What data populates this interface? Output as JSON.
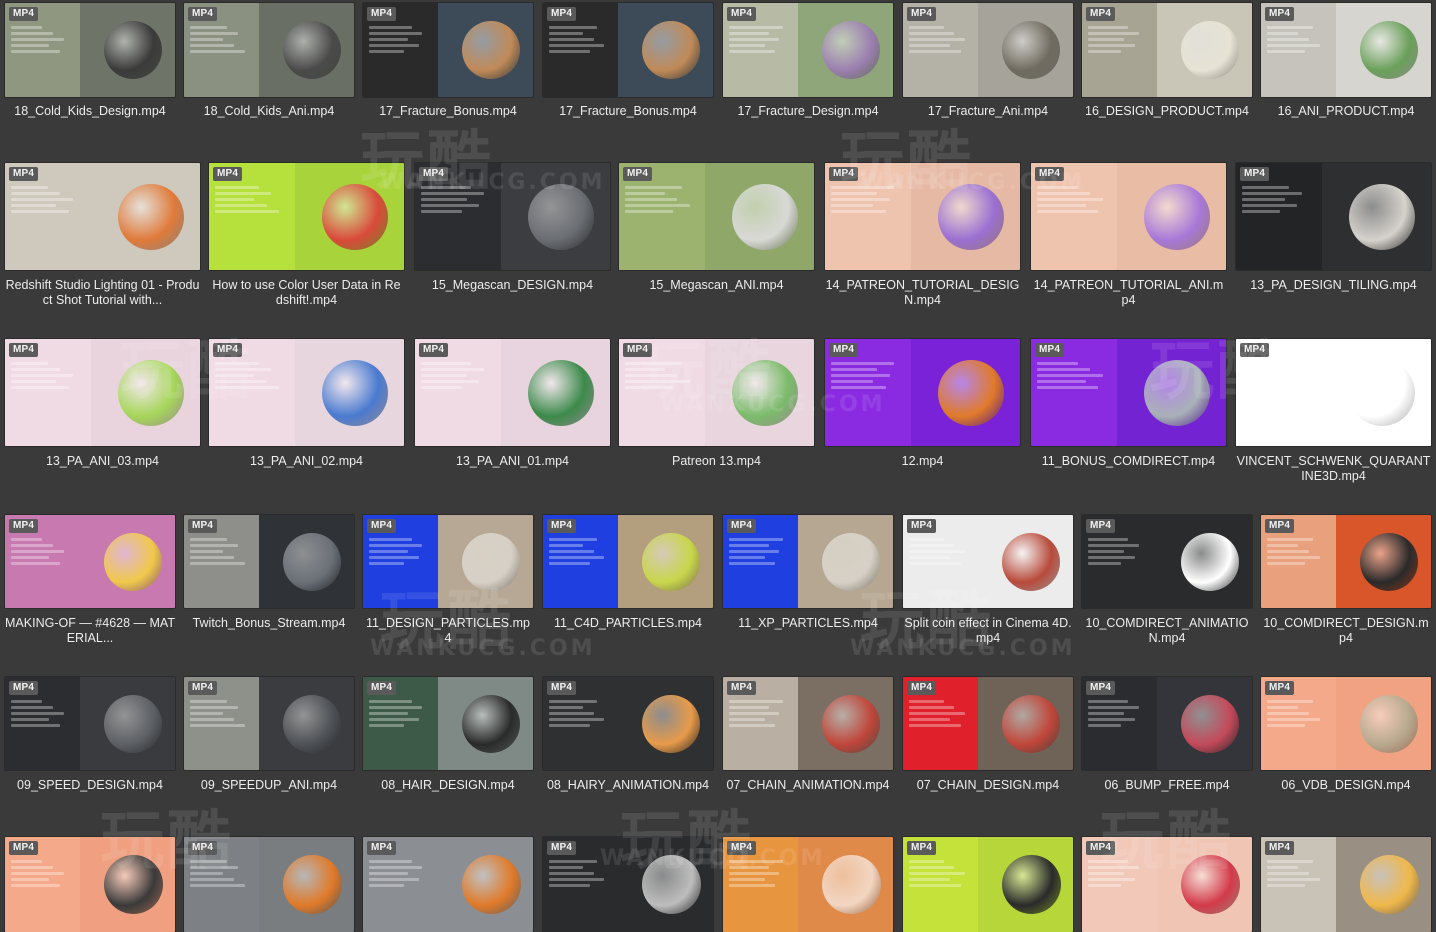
{
  "badge": "MP4",
  "watermark": {
    "brand": "玩酷",
    "url": "WANKUCG.COM"
  },
  "rows": [
    [
      {
        "name": "18_Cold_Kids_Design.mp4",
        "bg": "#6f7469",
        "panel": "#8f9780",
        "art": "#3a3a3a"
      },
      {
        "name": "18_Cold_Kids_Ani.mp4",
        "bg": "#6a6f66",
        "panel": "#8b9180",
        "art": "#4a4a4a"
      },
      {
        "name": "17_Fracture_Bonus.mp4",
        "bg": "#3d4a58",
        "panel": "#2a2a2a",
        "art": "#c08a58"
      },
      {
        "name": "17_Fracture_Bonus.mp4",
        "bg": "#3d4a58",
        "panel": "#2a2a2a",
        "art": "#c08a58"
      },
      {
        "name": "17_Fracture_Design.mp4",
        "bg": "#8fa57a",
        "panel": "#b7bba6",
        "art": "#9b7fb0"
      },
      {
        "name": "17_Fracture_Ani.mp4",
        "bg": "#a6a39a",
        "panel": "#b4b1a6",
        "art": "#6f6b60"
      },
      {
        "name": "16_DESIGN_PRODUCT.mp4",
        "bg": "#c9c6b8",
        "panel": "#a8a493",
        "art": "#e6e2d4"
      },
      {
        "name": "16_ANI_PRODUCT.mp4",
        "bg": "#d7d5cf",
        "panel": "#c5c3bc",
        "art": "#6aa05a"
      }
    ],
    [
      {
        "name": "Redshift Studio Lighting 01 - Product Shot Tutorial with...",
        "bg": "#cfc9bd",
        "panel": "#cfc9bd",
        "art": "#e07a3a"
      },
      {
        "name": "How to use Color User Data in Redshift!.mp4",
        "bg": "#a9d33a",
        "panel": "#b6e03c",
        "art": "#d94a3a"
      },
      {
        "name": "15_Megascan_DESIGN.mp4",
        "bg": "#3b3d40",
        "panel": "#2c2d30",
        "art": "#6a6d72"
      },
      {
        "name": "15_Megascan_ANI.mp4",
        "bg": "#8fa86a",
        "panel": "#9cb36f",
        "art": "#d8d8d6"
      },
      {
        "name": "14_PATREON_TUTORIAL_DESIGN.mp4",
        "bg": "#e6b9a4",
        "panel": "#efc4af",
        "art": "#9a6fd2"
      },
      {
        "name": "14_PATREON_TUTORIAL_ANI.mp4",
        "bg": "#e9bca6",
        "panel": "#efc4af",
        "art": "#a878d8"
      },
      {
        "name": "13_PA_DESIGN_TILING.mp4",
        "bg": "#2e2f31",
        "panel": "#232426",
        "art": "#d6d2cc"
      }
    ],
    [
      {
        "name": "13_PA_ANI_03.mp4",
        "bg": "#e9d3dd",
        "panel": "#f0dbe4",
        "art": "#a6d65a"
      },
      {
        "name": "13_PA_ANI_02.mp4",
        "bg": "#e8d6df",
        "panel": "#f0dbe4",
        "art": "#4a7ad0"
      },
      {
        "name": "13_PA_ANI_01.mp4",
        "bg": "#e7d4de",
        "panel": "#f0dbe4",
        "art": "#3c8a4a"
      },
      {
        "name": "Patreon 13.mp4",
        "bg": "#e8d5de",
        "panel": "#f0dbe4",
        "art": "#7bbb6a"
      },
      {
        "name": "12.mp4",
        "bg": "#7a22d8",
        "panel": "#8a2be2",
        "art": "#e07a2a"
      },
      {
        "name": "11_BONUS_COMDIRECT.mp4",
        "bg": "#7423d2",
        "panel": "#8a2be2",
        "art": "#a9b1b8"
      },
      {
        "name": "VINCENT_SCHWENK_QUARANTINE3D.mp4",
        "bg": "#ffffff",
        "panel": "#ffffff",
        "art": "#ffffff"
      }
    ],
    [
      {
        "name": "MAKING-OF — #4628 — MATERIAL...",
        "bg": "#c87ab0",
        "panel": "#c87ab0",
        "art": "#f0c84a"
      },
      {
        "name": "Twitch_Bonus_Stream.mp4",
        "bg": "#2f3236",
        "panel": "#8e8e8a",
        "art": "#6b7078"
      },
      {
        "name": "11_DESIGN_PARTICLES.mp4",
        "bg": "#b7a895",
        "panel": "#1f3fe0",
        "art": "#d6d0c6"
      },
      {
        "name": "11_C4D_PARTICLES.mp4",
        "bg": "#b39e7e",
        "panel": "#1f3fe0",
        "art": "#c8d64a"
      },
      {
        "name": "11_XP_PARTICLES.mp4",
        "bg": "#b5a792",
        "panel": "#1f3fe0",
        "art": "#d6d0c6"
      },
      {
        "name": "Split coin effect in Cinema 4D.mp4",
        "bg": "#ececec",
        "panel": "#ececec",
        "art": "#b84a3a"
      },
      {
        "name": "10_COMDIRECT_ANIMATION.mp4",
        "bg": "#2a2b2d",
        "panel": "#2a2b2d",
        "art": "#ffffff"
      },
      {
        "name": "10_COMDIRECT_DESIGN.mp4",
        "bg": "#d9562a",
        "panel": "#e9a07c",
        "art": "#2a2a2a"
      }
    ],
    [
      {
        "name": "09_SPEED_DESIGN.mp4",
        "bg": "#393b3e",
        "panel": "#2c2d30",
        "art": "#5d6064"
      },
      {
        "name": "09_SPEEDUP_ANI.mp4",
        "bg": "#3a3c3f",
        "panel": "#8e918a",
        "art": "#4e5155"
      },
      {
        "name": "08_HAIR_DESIGN.mp4",
        "bg": "#7f8a86",
        "panel": "#3d5a48",
        "art": "#2a2a2a"
      },
      {
        "name": "08_HAIRY_ANIMATION.mp4",
        "bg": "#2e3032",
        "panel": "#2e3032",
        "art": "#e89a4a"
      },
      {
        "name": "07_CHAIN_ANIMATION.mp4",
        "bg": "#7a6f62",
        "panel": "#b9b0a3",
        "art": "#c0463a"
      },
      {
        "name": "07_CHAIN_DESIGN.mp4",
        "bg": "#6f6358",
        "panel": "#e0202a",
        "art": "#c0463a"
      },
      {
        "name": "06_BUMP_FREE.mp4",
        "bg": "#33353a",
        "panel": "#2a2c30",
        "art": "#c44a5a"
      },
      {
        "name": "06_VDB_DESIGN.mp4",
        "bg": "#f0a283",
        "panel": "#f4a98a",
        "art": "#b7a98e"
      }
    ],
    [
      {
        "name": "",
        "bg": "#f0a080",
        "panel": "#f4a98a",
        "art": "#3a3a3a"
      },
      {
        "name": "",
        "bg": "#7a7d80",
        "panel": "#7d8084",
        "art": "#e07a2a"
      },
      {
        "name": "",
        "bg": "#8b8e92",
        "panel": "#8b8e92",
        "art": "#e07a2a"
      },
      {
        "name": "",
        "bg": "#2a2b2d",
        "panel": "#2a2b2d",
        "art": "#bdbdbd"
      },
      {
        "name": "",
        "bg": "#e08a4a",
        "panel": "#e8953f",
        "art": "#f2d6c2"
      },
      {
        "name": "",
        "bg": "#b6d63a",
        "panel": "#c4e23a",
        "art": "#2a2a2a"
      },
      {
        "name": "",
        "bg": "#f0c5b4",
        "panel": "#f2c9b9",
        "art": "#d33a4a"
      },
      {
        "name": "",
        "bg": "#9a8f83",
        "panel": "#c8c2b7",
        "art": "#f0b84a"
      }
    ]
  ]
}
